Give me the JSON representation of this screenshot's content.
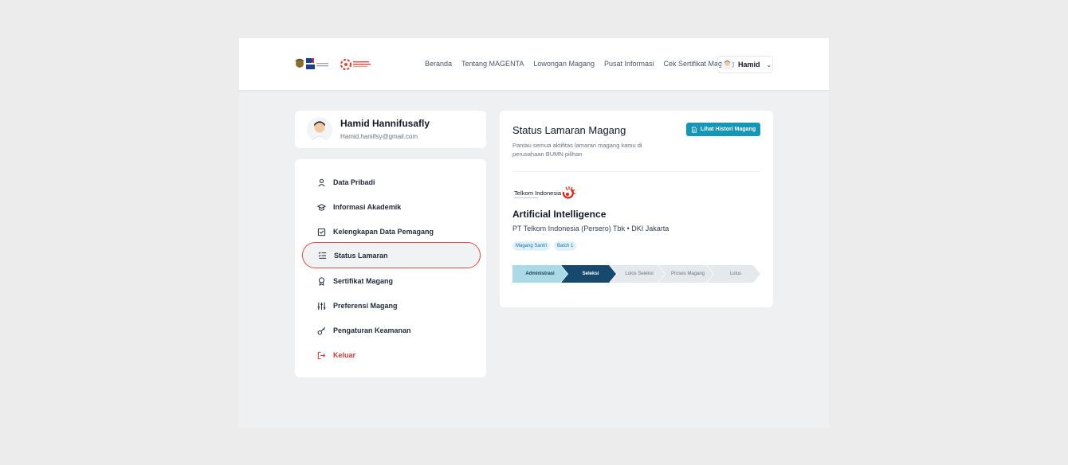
{
  "nav": {
    "links": [
      "Beranda",
      "Tentang MAGENTA",
      "Lowongan Magang",
      "Pusat Informasi",
      "Cek Sertifikat Magang"
    ],
    "user_name": "Hamid"
  },
  "profile": {
    "name": "Hamid Hannifusafly",
    "email": "Hamid.haniifsy@gmail.com"
  },
  "menu": {
    "items": [
      {
        "label": "Data Pribadi",
        "icon": "user-icon"
      },
      {
        "label": "Informasi Akademik",
        "icon": "graduation-cap-icon"
      },
      {
        "label": "Kelengkapan Data Pemagang",
        "icon": "checkbox-icon"
      },
      {
        "label": "Status Lamaran",
        "icon": "list-check-icon",
        "active": true
      },
      {
        "label": "Sertifikat Magang",
        "icon": "award-icon"
      },
      {
        "label": "Preferensi Magang",
        "icon": "sliders-icon"
      },
      {
        "label": "Pengaturan Keamanan",
        "icon": "key-icon"
      },
      {
        "label": "Keluar",
        "icon": "logout-icon"
      }
    ]
  },
  "status": {
    "title": "Status Lamaran Magang",
    "description": "Pantau semua aktifitas lamaran magang kamu di perusahaan BUMN pilihan",
    "history_button": "Lihat Histori Magang",
    "company_logo_text": "Telkom Indonesia",
    "job_title": "Artificial Intelligence",
    "company_line": "PT Telkom Indonesia (Persero) Tbk • DKI Jakarta",
    "tags": [
      "Magang Santri",
      "Batch 1"
    ],
    "steps": [
      "Administrasi",
      "Seleksi",
      "Lolos Seleksi",
      "Proses Magang",
      "Lulus"
    ],
    "current_step": "Seleksi"
  },
  "colors": {
    "accent": "#1496b8",
    "step_done": "#a9dbe6",
    "step_active": "#17486e",
    "step_pending": "#e5e9ec",
    "active_outline": "#e04a3f",
    "logout": "#e53935"
  }
}
